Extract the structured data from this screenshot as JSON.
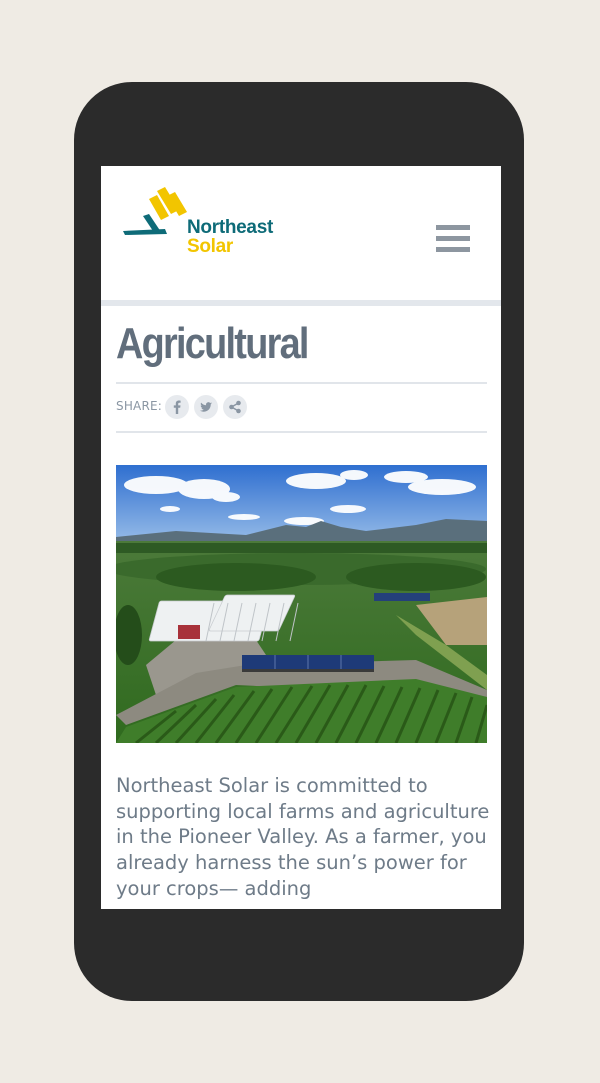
{
  "brand": {
    "name_line1": "Northeast",
    "name_line2": "Solar",
    "colors": {
      "teal": "#0e6b78",
      "yellow": "#f2c500"
    }
  },
  "header": {
    "menu_icon": "hamburger-menu-icon"
  },
  "page": {
    "title": "Agricultural",
    "share": {
      "label": "SHARE:",
      "buttons": [
        {
          "network": "Facebook",
          "icon": "facebook-icon"
        },
        {
          "network": "Twitter",
          "icon": "twitter-icon"
        },
        {
          "network": "Share",
          "icon": "share-icon"
        }
      ]
    },
    "hero_image": {
      "subject": "aerial-farm-greenhouses-solar-array"
    },
    "body_text": "Northeast Solar is committed to supporting local farms and agriculture in the Pioneer Valley. As a farmer, you already harness the sun’s power for your crops— adding"
  },
  "theme": {
    "background": "#efebe4",
    "phone_frame": "#2b2b2b",
    "title_color": "#616e7c",
    "body_color": "#6e7b88"
  }
}
